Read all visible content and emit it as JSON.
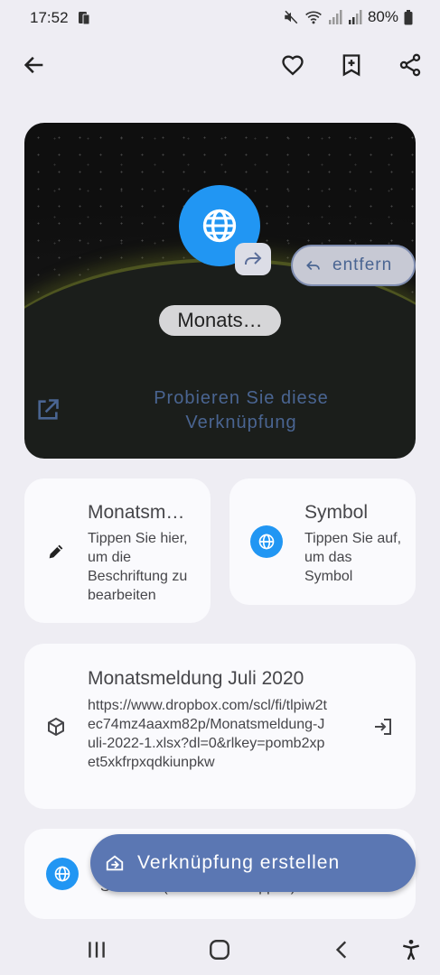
{
  "status_bar": {
    "time": "17:52",
    "battery": "80%"
  },
  "header": {
    "back_icon": "arrow-left-icon",
    "favorite_icon": "heart-icon",
    "bookmark_icon": "bookmark-add-icon",
    "share_icon": "share-icon"
  },
  "preview": {
    "remove_label": "entfern",
    "shortcut_label": "Monats…",
    "try_label": "Probieren Sie diese Verknüpfung"
  },
  "label_card": {
    "title": "Monatsm…",
    "subtitle": "Tippen Sie hier, um die Beschriftung zu bearbeiten"
  },
  "icon_card": {
    "title": "Symbol",
    "subtitle": "Tippen Sie auf, um das Symbol"
  },
  "link_card": {
    "title": "Monatsmeldung Juli 2020",
    "url": "https://www.dropbox.com/scl/fi/tlpiw2tec74mz4aaxm82p/Monatsmeldung-Juli-2022-1.xlsx?dl=0&rlkey=pomb2xpet5xkfrpxqdkiunpkw"
  },
  "browser_card": {
    "subtitle": "Standard (Zum Ändern tippen)"
  },
  "fab": {
    "label": "Verknüpfung erstellen"
  },
  "colors": {
    "accent": "#4a6592",
    "fab": "#5b77b3",
    "globe": "#2196f3",
    "background": "#eeedf3"
  }
}
